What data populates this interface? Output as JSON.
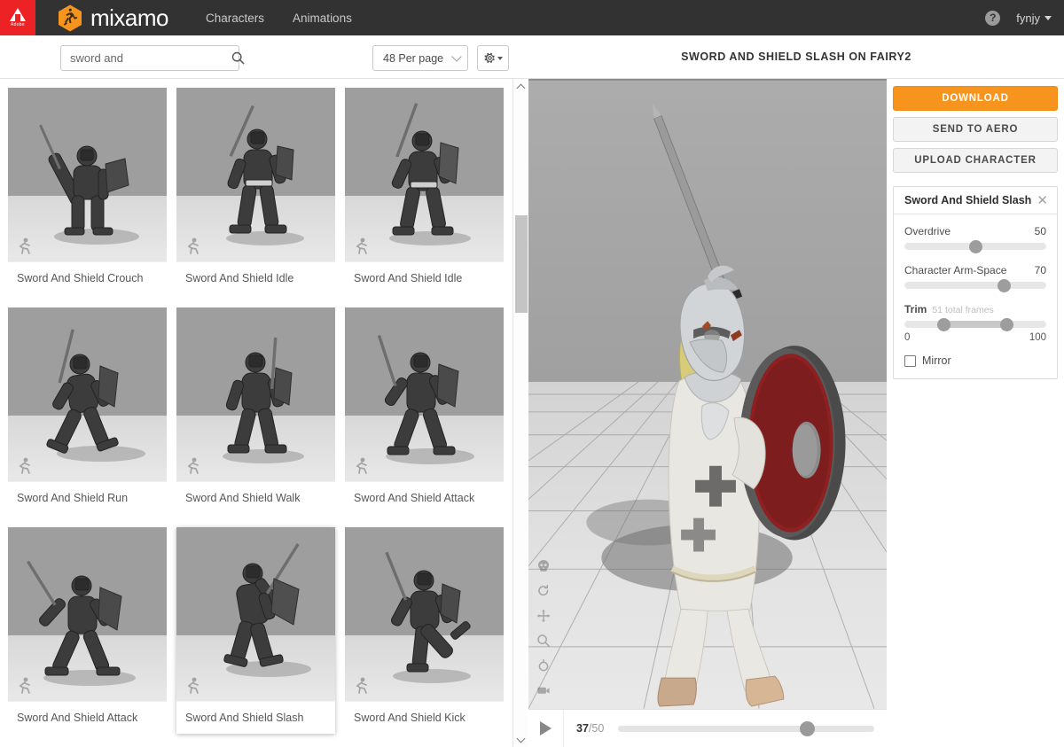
{
  "header": {
    "adobe_label": "Adobe",
    "brand": "mixamo",
    "nav": [
      {
        "label": "Characters"
      },
      {
        "label": "Animations"
      }
    ],
    "help": "?",
    "user": "fynjy"
  },
  "toolbar": {
    "search_value": "sword and",
    "search_placeholder": "Search",
    "per_page": "48 Per page",
    "gear_tooltip": "Settings"
  },
  "grid": {
    "cards": [
      {
        "label": "Sword And Shield Crouch",
        "selected": false,
        "pose": "crouch"
      },
      {
        "label": "Sword And Shield Idle",
        "selected": false,
        "pose": "idle"
      },
      {
        "label": "Sword And Shield Idle",
        "selected": false,
        "pose": "idle2"
      },
      {
        "label": "Sword And Shield Run",
        "selected": false,
        "pose": "run"
      },
      {
        "label": "Sword And Shield Walk",
        "selected": false,
        "pose": "walk"
      },
      {
        "label": "Sword And Shield Attack",
        "selected": false,
        "pose": "attack"
      },
      {
        "label": "Sword And Shield Attack",
        "selected": false,
        "pose": "attack2"
      },
      {
        "label": "Sword And Shield Slash",
        "selected": true,
        "pose": "slash"
      },
      {
        "label": "Sword And Shield Kick",
        "selected": false,
        "pose": "kick"
      }
    ]
  },
  "viewer": {
    "title": "SWORD AND SHIELD SLASH ON FAIRY2",
    "tools": [
      {
        "name": "skull-icon"
      },
      {
        "name": "rotate-icon"
      },
      {
        "name": "pan-icon"
      },
      {
        "name": "zoom-icon"
      },
      {
        "name": "orbit-icon"
      },
      {
        "name": "camera-icon"
      }
    ]
  },
  "playback": {
    "play_icon": "play-icon",
    "current_frame": "37",
    "separator": "/",
    "total_frames": "50",
    "progress_percent": 74
  },
  "sidebar": {
    "download_label": "DOWNLOAD",
    "send_to_aero_label": "SEND TO AERO",
    "upload_character_label": "UPLOAD CHARACTER",
    "accent_color": "#f7941e",
    "settings": {
      "title": "Sword And Shield Slash",
      "close_icon": "✕",
      "sliders": [
        {
          "label": "Overdrive",
          "value": "50",
          "percent": 50
        },
        {
          "label": "Character Arm-Space",
          "value": "70",
          "percent": 70
        }
      ],
      "trim": {
        "title": "Trim",
        "subtitle": "51 total frames",
        "start_percent": 28,
        "end_percent": 72,
        "min_label": "0",
        "max_label": "100"
      },
      "mirror": {
        "label": "Mirror",
        "checked": false
      }
    }
  }
}
